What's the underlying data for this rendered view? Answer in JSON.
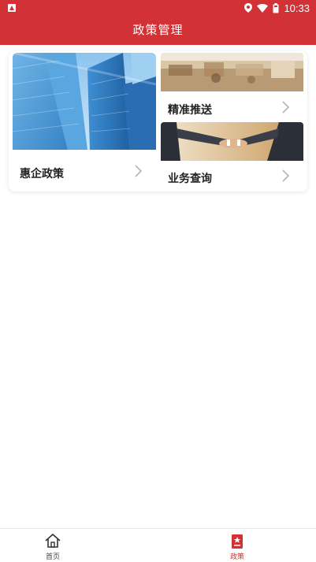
{
  "status_bar": {
    "time": "10:33",
    "icons": [
      "notification-a-icon",
      "location-icon",
      "wifi-icon",
      "battery-icon"
    ]
  },
  "header": {
    "title": "政策管理"
  },
  "cards": {
    "left": {
      "label": "惠企政策",
      "image": "buildings-photo"
    },
    "right_top": {
      "label": "精准推送",
      "image": "office-photo"
    },
    "right_bottom": {
      "label": "业务查询",
      "image": "handshake-photo"
    }
  },
  "bottom_nav": {
    "items": [
      {
        "label": "首页",
        "icon": "home-icon",
        "active": false
      },
      {
        "label": "政策",
        "icon": "policy-book-icon",
        "active": true
      }
    ]
  },
  "colors": {
    "brand_red": "#d23236",
    "text_dark": "#222222",
    "chevron_gray": "#b5b5b5"
  }
}
